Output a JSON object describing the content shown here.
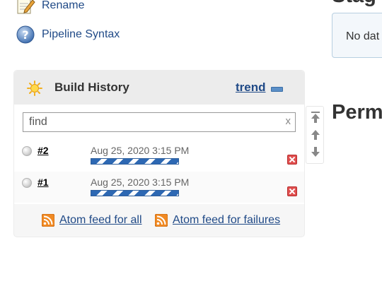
{
  "sidebar": {
    "rename_label": "Rename",
    "pipeline_syntax_label": "Pipeline Syntax"
  },
  "build_history": {
    "title": "Build History",
    "trend_label": "trend",
    "search": {
      "value": "find",
      "clear_label": "x"
    },
    "builds": [
      {
        "number": "#2",
        "date": "Aug 25, 2020 3:15 PM",
        "status": "not-built-grey",
        "progress": "indeterminate"
      },
      {
        "number": "#1",
        "date": "Aug 25, 2020 3:15 PM",
        "status": "not-built-grey",
        "progress": "indeterminate"
      }
    ],
    "feeds": {
      "all_label": "Atom feed for all",
      "failures_label": "Atom feed for failures"
    }
  },
  "main": {
    "stage_heading": "Stag",
    "no_data_text": "No dat",
    "permalinks_heading": "Perm"
  },
  "icons": {
    "rename": "notepad-pencil-icon",
    "pipeline_syntax": "help-question-icon",
    "build_history": "sun-weather-icon",
    "collapse": "collapse-minus-icon",
    "stop": "stop-x-icon",
    "rss": "rss-feed-icon",
    "scroll_top": "scroll-top-icon",
    "scroll_up": "arrow-up-icon",
    "scroll_down": "arrow-down-icon"
  },
  "colors": {
    "link": "#204a87",
    "progress": "#2d68b3",
    "stop": "#e05050",
    "rss": "#f08a24",
    "panel_header": "#ececec"
  }
}
